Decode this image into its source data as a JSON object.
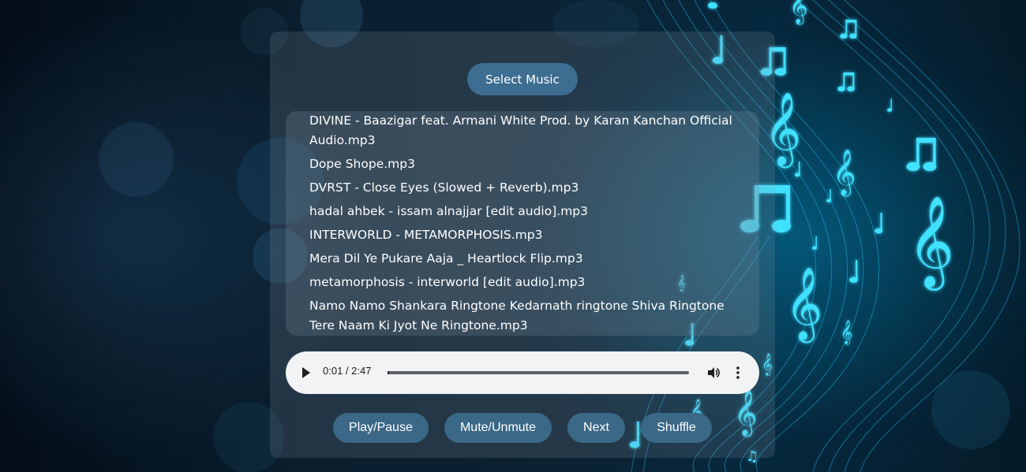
{
  "select_button": {
    "label": "Select Music"
  },
  "playlist": {
    "tracks": [
      "DIVINE - Baazigar feat. Armani White Prod. by Karan Kanchan Official Audio.mp3",
      "Dope Shope.mp3",
      "DVRST - Close Eyes (Slowed + Reverb).mp3",
      "hadal ahbek - issam alnajjar [edit audio].mp3",
      "INTERWORLD - METAMORPHOSIS.mp3",
      "Mera Dil Ye Pukare Aaja _ Heartlock Flip.mp3",
      "metamorphosis - interworld [edit audio].mp3",
      "Namo Namo Shankara Ringtone Kedarnath ringtone Shiva Ringtone Tere Naam Ki Jyot Ne Ringtone.mp3"
    ]
  },
  "audio_player": {
    "time_display": "0:01 / 2:47",
    "progress_fraction": 0.006
  },
  "controls": {
    "play_pause": "Play/Pause",
    "mute_unmute": "Mute/Unmute",
    "next": "Next",
    "shuffle": "Shuffle"
  },
  "colors": {
    "button_bg": "#3a6886",
    "accent_glow": "#21d4fd",
    "panel_overlay": "rgba(150,160,170,0.18)"
  },
  "icons": {
    "play": "play-icon",
    "volume": "volume-icon",
    "more": "more-options-icon",
    "background": "music-notes-background"
  }
}
